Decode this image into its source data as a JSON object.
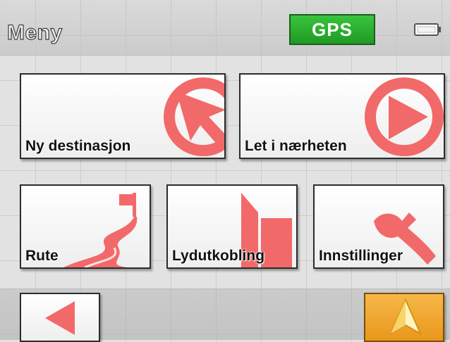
{
  "header": {
    "title": "Meny",
    "gps_label": "GPS",
    "battery_icon": "battery-icon"
  },
  "menu": {
    "new_destination": "Ny destinasjon",
    "nearby": "Let i nærheten",
    "route": "Rute",
    "mute": "Lydutkobling",
    "settings": "Innstillinger"
  },
  "footer": {
    "back_icon": "back-arrow-icon",
    "map_icon": "navigation-arrow-icon"
  },
  "colors": {
    "accent_icon": "#f2696a",
    "gps_green": "#2aae2e",
    "map_button": "#f0a623"
  }
}
